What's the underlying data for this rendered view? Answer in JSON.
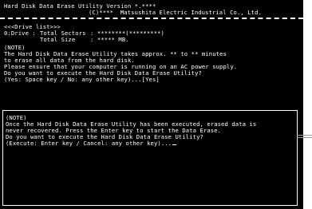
{
  "header": {
    "title": "Hard Disk Data Erase Utility Version *.****",
    "copyright": "(C)****  Matsushita Electric Industrial Co., Ltd."
  },
  "drive_list": {
    "heading": "<<<Drive list>>>",
    "drive": "0:Drive :",
    "sectors_label": "Total Sectors",
    "sectors_value": ": ********(*********)",
    "size_label": "Total Size",
    "size_value": ": ***** MB."
  },
  "note1": {
    "heading": "(NOTE)",
    "lines": [
      "The Hard Disk Data Erase Utility takes approx. ** to ** minutes",
      "to erase all data from the hard disk.",
      "Please ensure that your computer is running on an AC power supply.",
      "Do you want to execute the Hard Disk Data Erase Utility?",
      "(Yes: Space key / No: any other key)...[Yes]"
    ]
  },
  "note2": {
    "heading": "(NOTE)",
    "lines": [
      "Once the Hard Disk Data Erase Utility has been executed, erased data is",
      "never recovered. Press the Enter key to start the Data Erase.",
      "Do you want to execute the Hard Disk Data Erase Utility?",
      "(Execute: Enter key / Cancel: any other key)..."
    ]
  }
}
